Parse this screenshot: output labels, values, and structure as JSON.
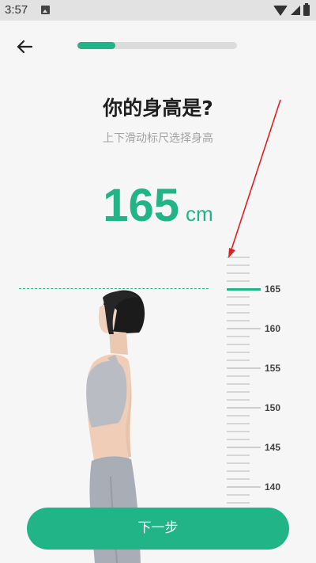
{
  "status_bar": {
    "time": "3:57",
    "icons": [
      "image-icon",
      "wifi-icon",
      "signal-icon",
      "battery-icon"
    ]
  },
  "header": {
    "back_icon": "arrow-left-icon",
    "progress_fraction": 0.24
  },
  "main": {
    "title": "你的身高是?",
    "subtitle": "上下滑动标尺选择身高",
    "height_value": "165",
    "height_unit": "cm"
  },
  "ruler": {
    "selected_value": 165,
    "labels": [
      "165",
      "160",
      "155",
      "150",
      "145",
      "140"
    ]
  },
  "footer": {
    "next_label": "下一步"
  },
  "colors": {
    "accent": "#21b486",
    "background": "#f6f6f6",
    "annotation_arrow": "#e02020"
  }
}
